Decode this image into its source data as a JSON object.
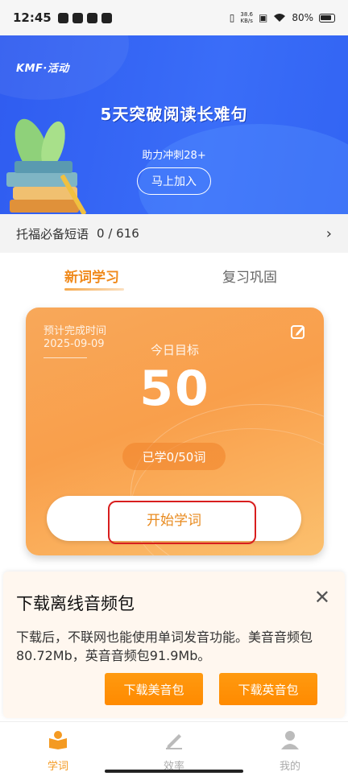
{
  "status_bar": {
    "time": "12:45",
    "network_speed_value": "38.6",
    "network_speed_unit": "KB/s",
    "battery": "80%"
  },
  "banner": {
    "logo": "KMF·活动",
    "title": "5天突破阅读长难句",
    "subtitle": "助力冲刺28+",
    "join_label": "马上加入"
  },
  "vocab_book": {
    "name": "托福必备短语",
    "progress": "0 / 616"
  },
  "tabs": [
    {
      "label": "新词学习",
      "active": true
    },
    {
      "label": "复习巩固",
      "active": false
    }
  ],
  "card": {
    "est_label": "预计完成时间",
    "est_date": "2025-09-09",
    "goal_label": "今日目标",
    "goal_value": "50",
    "learned": "已学0/50词",
    "start_label": "开始学词"
  },
  "popup": {
    "title": "下载离线音频包",
    "body": "下载后，不联网也能使用单词发音功能。美音音频包80.72Mb，英音音频包91.9Mb。",
    "download_us": "下载美音包",
    "download_uk": "下载英音包"
  },
  "bottom_nav": [
    {
      "label": "学词",
      "icon": "book-icon",
      "active": true
    },
    {
      "label": "效率",
      "icon": "pencil-icon",
      "active": false
    },
    {
      "label": "我的",
      "icon": "user-icon",
      "active": false
    }
  ],
  "colors": {
    "accent": "#f08a1c",
    "banner": "#3264f3",
    "download_button": "#ff8a00",
    "highlight_ring": "#d81e1e"
  }
}
